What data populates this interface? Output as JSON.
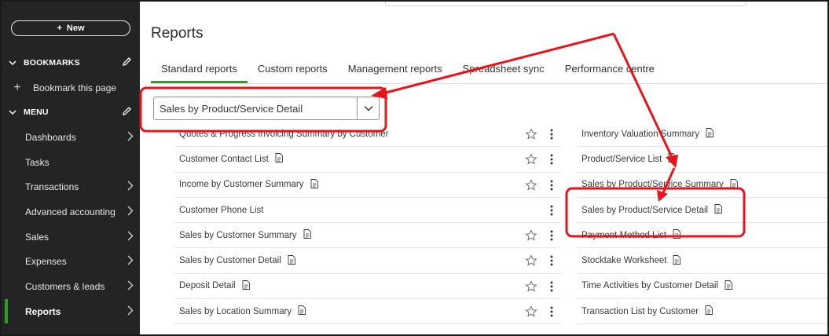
{
  "sidebar": {
    "new_label": "New",
    "bookmarks_label": "BOOKMARKS",
    "bookmark_this_page": "Bookmark this page",
    "menu_label": "MENU",
    "items": [
      {
        "label": "Dashboards",
        "has_arrow": true
      },
      {
        "label": "Tasks",
        "has_arrow": false
      },
      {
        "label": "Transactions",
        "has_arrow": true
      },
      {
        "label": "Advanced accounting",
        "has_arrow": true
      },
      {
        "label": "Sales",
        "has_arrow": true
      },
      {
        "label": "Expenses",
        "has_arrow": true
      },
      {
        "label": "Customers & leads",
        "has_arrow": true
      },
      {
        "label": "Reports",
        "has_arrow": true,
        "active": true
      }
    ]
  },
  "main": {
    "title": "Reports",
    "tabs": [
      {
        "label": "Standard reports",
        "active": true
      },
      {
        "label": "Custom reports"
      },
      {
        "label": "Management reports"
      },
      {
        "label": "Spreadsheet sync"
      },
      {
        "label": "Performance centre"
      }
    ],
    "search_dropdown": {
      "value": "Sales by Product/Service Detail"
    },
    "left_reports": [
      {
        "name": "Quotes & Progress Invoicing Summary by Customer",
        "doc": false,
        "star": true
      },
      {
        "name": "Customer Contact List",
        "doc": true,
        "star": true
      },
      {
        "name": "Income by Customer Summary",
        "doc": true,
        "star": true
      },
      {
        "name": "Customer Phone List",
        "doc": false,
        "star": false
      },
      {
        "name": "Sales by Customer Summary",
        "doc": true,
        "star": true
      },
      {
        "name": "Sales by Customer Detail",
        "doc": true,
        "star": true
      },
      {
        "name": "Deposit Detail",
        "doc": true,
        "star": true
      },
      {
        "name": "Sales by Location Summary",
        "doc": true,
        "star": true
      }
    ],
    "right_reports": [
      {
        "name": "Inventory Valuation Summary",
        "doc": true
      },
      {
        "name": "Product/Service List",
        "doc": true
      },
      {
        "name": "Sales by Product/Service Summary",
        "doc": true
      },
      {
        "name": "Sales by Product/Service Detail",
        "doc": true
      },
      {
        "name": "Payment Method List",
        "doc": true
      },
      {
        "name": "Stocktake Worksheet",
        "doc": true
      },
      {
        "name": "Time Activities by Customer Detail",
        "doc": true
      },
      {
        "name": "Transaction List by Customer",
        "doc": true
      }
    ]
  },
  "colors": {
    "sidebar_bg": "#222426",
    "accent_green": "#2ca01c",
    "annotation_red": "#e8131b",
    "text_dark": "#393a3d"
  },
  "icons": [
    "plus-icon",
    "chevron-down-icon",
    "pencil-icon",
    "chevron-right-icon",
    "star-icon",
    "kebab-menu-icon",
    "document-icon"
  ]
}
